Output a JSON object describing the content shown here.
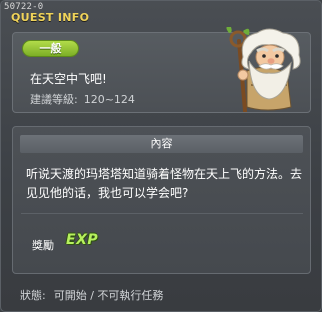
{
  "window": {
    "quest_id": "50722-0",
    "title": "QUEST INFO"
  },
  "header": {
    "category": "一般",
    "quest_name": "在天空中飞吧!",
    "level_label": "建議等級:",
    "level_range": "120~124",
    "npc_icon": "white-haired-elder-with-staff"
  },
  "content": {
    "section_title": "內容",
    "description": "听说天渡的玛塔塔知道骑着怪物在天上飞的方法。去见见他的话，我也可以学会吧?",
    "reward_label": "獎勵",
    "reward_item": "EXP"
  },
  "status": {
    "label": "狀態:",
    "value": "可開始 / 不可執行任務"
  },
  "colors": {
    "title_accent": "#f0d35a",
    "category_badge": "#8fc233",
    "exp_text": "#b6f05e",
    "background": "#3e4246"
  }
}
